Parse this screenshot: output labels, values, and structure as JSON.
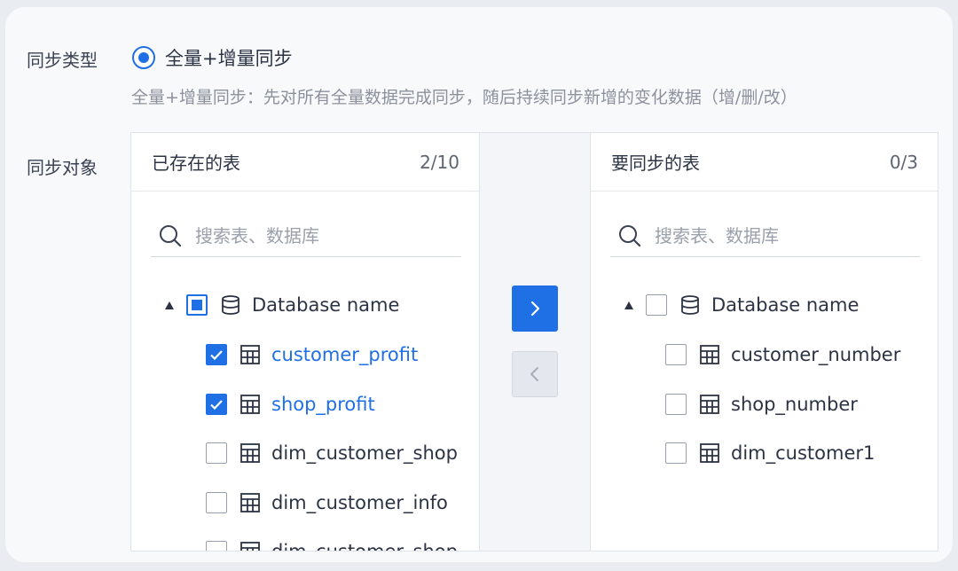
{
  "sync_type": {
    "label": "同步类型",
    "option_label": "全量+增量同步",
    "description": "全量+增量同步：先对所有全量数据完成同步，随后持续同步新增的变化数据（增/删/改）"
  },
  "sync_object": {
    "label": "同步对象"
  },
  "left_panel": {
    "title": "已存在的表",
    "count": "2/10",
    "search_placeholder": "搜索表、数据库",
    "database": "Database name",
    "tables": [
      {
        "name": "customer_profit",
        "checked": true
      },
      {
        "name": "shop_profit",
        "checked": true
      },
      {
        "name": "dim_customer_shop",
        "checked": false
      },
      {
        "name": "dim_customer_info",
        "checked": false
      },
      {
        "name": "dim_customer_shop",
        "checked": false
      }
    ]
  },
  "right_panel": {
    "title": "要同步的表",
    "count": "0/3",
    "search_placeholder": "搜索表、数据库",
    "database": "Database name",
    "tables": [
      {
        "name": "customer_number",
        "checked": false
      },
      {
        "name": "shop_number",
        "checked": false
      },
      {
        "name": "dim_customer1",
        "checked": false
      }
    ]
  },
  "colors": {
    "accent": "#1f6fe5",
    "muted": "#8b919d",
    "text": "#2b3344"
  },
  "icons": {
    "radio": "radio-selected-icon",
    "search": "search-icon",
    "database": "database-icon",
    "table": "table-icon",
    "move_right": "chevron-right-icon",
    "move_left": "chevron-left-icon"
  }
}
